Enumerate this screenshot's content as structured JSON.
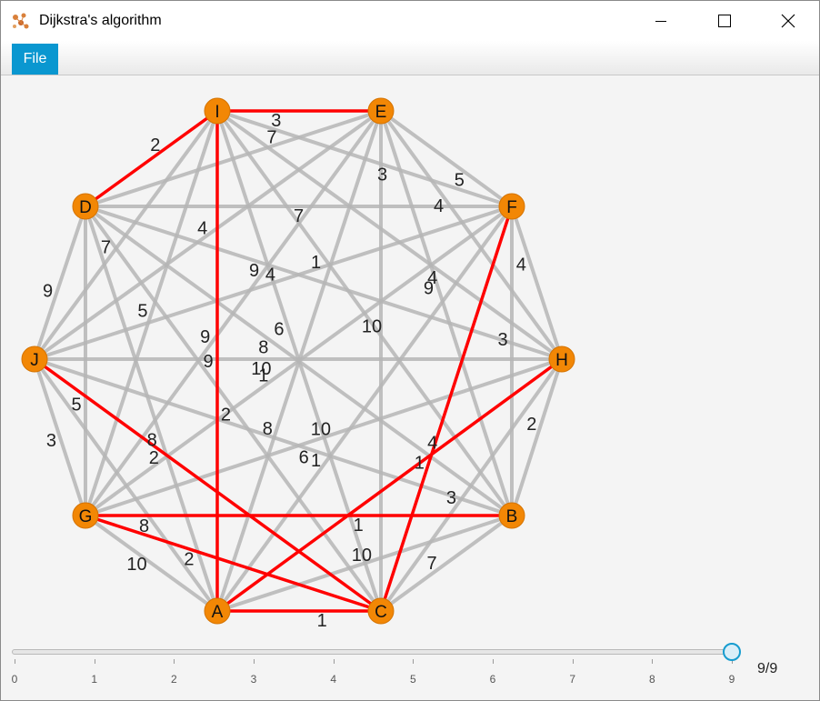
{
  "window": {
    "title": "Dijkstra's algorithm"
  },
  "menu": {
    "file_label": "File"
  },
  "colors": {
    "node_fill": "#f28705",
    "edge_default": "#b5b5b5",
    "edge_path": "#ff0000",
    "accent": "#0a97d0"
  },
  "graph": {
    "nodes": [
      "I",
      "E",
      "D",
      "F",
      "J",
      "H",
      "G",
      "B",
      "A",
      "C"
    ],
    "edges": [
      {
        "a": "I",
        "b": "E",
        "w": "3",
        "path": true
      },
      {
        "a": "I",
        "b": "D",
        "w": "2",
        "path": true
      },
      {
        "a": "I",
        "b": "A",
        "w": "9",
        "path": true
      },
      {
        "a": "I",
        "b": "F",
        "w": "3",
        "path": false
      },
      {
        "a": "I",
        "b": "H",
        "w": "4",
        "path": false
      },
      {
        "a": "I",
        "b": "B",
        "w": "1",
        "path": false
      },
      {
        "a": "I",
        "b": "C",
        "w": "6",
        "path": false
      },
      {
        "a": "I",
        "b": "G",
        "w": "5",
        "path": false
      },
      {
        "a": "I",
        "b": "J",
        "w": "7",
        "path": false
      },
      {
        "a": "E",
        "b": "F",
        "w": "5",
        "path": false
      },
      {
        "a": "E",
        "b": "D",
        "w": "7",
        "path": false
      },
      {
        "a": "E",
        "b": "C",
        "w": "10",
        "path": false
      },
      {
        "a": "E",
        "b": "J",
        "w": "4",
        "path": false
      },
      {
        "a": "E",
        "b": "G",
        "w": "9",
        "path": false
      },
      {
        "a": "E",
        "b": "A",
        "w": "8",
        "path": false
      },
      {
        "a": "E",
        "b": "H",
        "w": "4",
        "path": false
      },
      {
        "a": "E",
        "b": "B",
        "w": "9",
        "path": false
      },
      {
        "a": "D",
        "b": "F",
        "w": "7",
        "path": false
      },
      {
        "a": "D",
        "b": "J",
        "w": "9",
        "path": false
      },
      {
        "a": "D",
        "b": "G",
        "w": "5",
        "path": false
      },
      {
        "a": "D",
        "b": "H",
        "w": "9",
        "path": false
      },
      {
        "a": "D",
        "b": "B",
        "w": "8",
        "path": false
      },
      {
        "a": "D",
        "b": "C",
        "w": "2",
        "path": false
      },
      {
        "a": "D",
        "b": "A",
        "w": "8",
        "path": false
      },
      {
        "a": "F",
        "b": "C",
        "w": "1",
        "path": true
      },
      {
        "a": "F",
        "b": "H",
        "w": "4",
        "path": false
      },
      {
        "a": "F",
        "b": "B",
        "w": "3",
        "path": false
      },
      {
        "a": "F",
        "b": "J",
        "w": "4",
        "path": false
      },
      {
        "a": "F",
        "b": "G",
        "w": "1",
        "path": false
      },
      {
        "a": "F",
        "b": "A",
        "w": "1",
        "path": false
      },
      {
        "a": "J",
        "b": "C",
        "w": "2",
        "path": true
      },
      {
        "a": "J",
        "b": "H",
        "w": "10",
        "path": false
      },
      {
        "a": "J",
        "b": "G",
        "w": "3",
        "path": false
      },
      {
        "a": "J",
        "b": "B",
        "w": "6",
        "path": false
      },
      {
        "a": "J",
        "b": "A",
        "w": "8",
        "path": false
      },
      {
        "a": "H",
        "b": "A",
        "w": "4",
        "path": true
      },
      {
        "a": "H",
        "b": "B",
        "w": "2",
        "path": false
      },
      {
        "a": "H",
        "b": "G",
        "w": "10",
        "path": false
      },
      {
        "a": "H",
        "b": "C",
        "w": "3",
        "path": false
      },
      {
        "a": "G",
        "b": "B",
        "w": "1",
        "path": true
      },
      {
        "a": "G",
        "b": "C",
        "w": "2",
        "path": true
      },
      {
        "a": "G",
        "b": "A",
        "w": "10",
        "path": false
      },
      {
        "a": "B",
        "b": "A",
        "w": "10",
        "path": false
      },
      {
        "a": "B",
        "b": "C",
        "w": "7",
        "path": false
      },
      {
        "a": "A",
        "b": "C",
        "w": "1",
        "path": true
      }
    ]
  },
  "slider": {
    "min": 0,
    "max": 9,
    "value": 9,
    "tick_labels": [
      "0",
      "1",
      "2",
      "3",
      "4",
      "5",
      "6",
      "7",
      "8",
      "9"
    ],
    "counter_text": "9/9"
  }
}
